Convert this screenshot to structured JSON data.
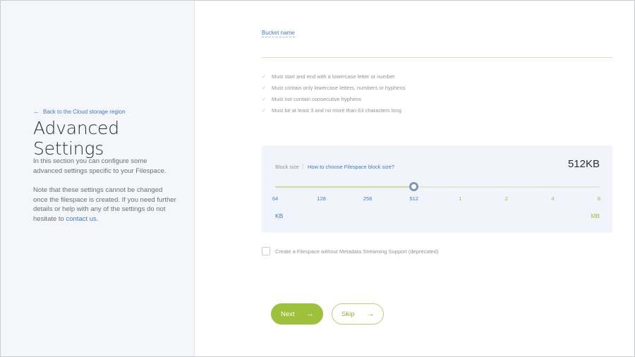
{
  "sidebar": {
    "back_link": "Back to the Cloud storage region",
    "title": "Advanced Settings",
    "desc1": "In this section you can configure some advanced  settings specific to your Filespace.",
    "desc2_prefix": "Note that these settings  cannot be changed once the filespace is created. If you need further  details or help with any of the settings do not hesitate to ",
    "contact_link": "contact us",
    "desc2_suffix": "."
  },
  "bucket": {
    "label": "Bucket name",
    "value": "",
    "rules": [
      "Must start and end with a lowercase letter or number",
      "Must contain only lowercase letters, numbers or hyphens",
      "Must not contain consecutive hyphens",
      "Must be at least 3 and no more than 63 characters long"
    ]
  },
  "block_size": {
    "label": "Block size",
    "separator": "|",
    "help_link": "How to choose Filespace block size?",
    "value": "512KB",
    "ticks": [
      "64",
      "128",
      "256",
      "512",
      "1",
      "2",
      "4",
      "8"
    ],
    "selected_index": 3,
    "unit_left": "KB",
    "unit_right": "MB"
  },
  "metadata_option": {
    "label": "Create a Filespace without Metadata Streaming Support (deprecated)",
    "checked": false
  },
  "actions": {
    "next_label": "Next",
    "skip_label": "Skip"
  },
  "colors": {
    "accent_green": "#9dc13b",
    "link_blue": "#3d7cc9",
    "panel_bg": "#f1f5fb",
    "sidebar_bg": "#f4f6f9"
  },
  "icons": {
    "back": "arrow-left-icon",
    "rule_check": "check-icon",
    "button_arrow": "arrow-right-icon"
  }
}
